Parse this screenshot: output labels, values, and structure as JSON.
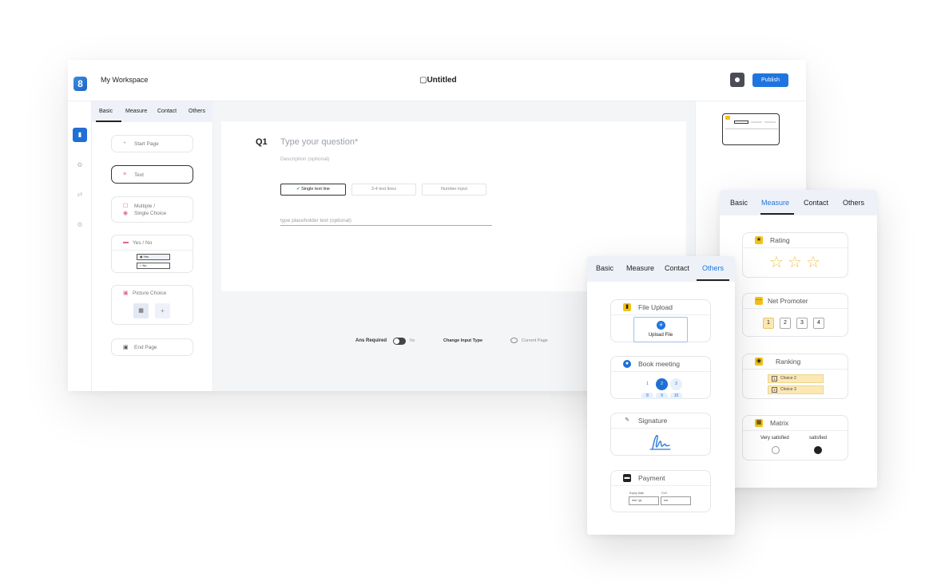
{
  "app": {
    "logo_letter": "8",
    "workspace": "My Workspace",
    "title": "Untitled",
    "publish_label": "Publish"
  },
  "colors": {
    "accent": "#1f75e0",
    "highlight": "#f3c318",
    "panel_tabs_bg": "#eef2f8"
  },
  "icons": {
    "logo": "app-logo-icon",
    "preview": "eye-icon",
    "rail": [
      "document-icon",
      "palette-icon",
      "shuffle-icon",
      "gear-icon"
    ]
  },
  "left_panel": {
    "tabs": [
      "Basic",
      "Measure",
      "Contact",
      "Others"
    ],
    "active_tab": "Basic",
    "elements": {
      "start_page": "Start Page",
      "text": "Text",
      "multiple_line1": "Multiple /",
      "multiple_line2": "Single Choice",
      "yes_no": "Yes / No",
      "yes": "Yes",
      "no": "No",
      "picture_choice": "Picture Choice",
      "end_page": "End Page"
    }
  },
  "question": {
    "number": "Q1",
    "text": "Type your question*",
    "description": "Description (optional)",
    "input_types": [
      "Single text line",
      "3-4 text lines",
      "Number input"
    ],
    "selected_input_type": "Single text line",
    "placeholder": "type placeholder text (optional)"
  },
  "bottom_bar": {
    "ans_required": "Ans Required",
    "toggle_state": "No",
    "change_input_type": "Change Input Type",
    "current_page": "Current Page"
  },
  "measure_panel": {
    "tabs": [
      "Basic",
      "Measure",
      "Contact",
      "Others"
    ],
    "active_tab": "Measure",
    "rating": {
      "title": "Rating",
      "stars": 3
    },
    "net_promoter": {
      "title": "Net Promoter",
      "options": [
        "1",
        "2",
        "3",
        "4"
      ],
      "selected": "1"
    },
    "ranking": {
      "title": "Ranking",
      "choices": [
        {
          "num": "1",
          "label": "Choice 2"
        },
        {
          "num": "2",
          "label": "Choice 3"
        }
      ]
    },
    "matrix": {
      "title": "Matrix",
      "columns": [
        "Very satisfied",
        "satisfied"
      ],
      "selected": "satisfied"
    }
  },
  "others_panel": {
    "tabs": [
      "Basic",
      "Measure",
      "Contact",
      "Others"
    ],
    "active_tab": "Others",
    "file_upload": {
      "title": "File Upload",
      "button": "Upload File"
    },
    "book_meeting": {
      "title": "Book meeting",
      "slots_row1": [
        "1",
        "2",
        "3"
      ],
      "slots_row2": [
        "8",
        "9",
        "10"
      ],
      "selected": "2"
    },
    "signature": {
      "title": "Signature"
    },
    "payment": {
      "title": "Payment",
      "expiry_label": "Expiry Date",
      "expiry_value": "mm / yy",
      "cvc_label": "CVC",
      "cvc_value": "cvc"
    }
  }
}
